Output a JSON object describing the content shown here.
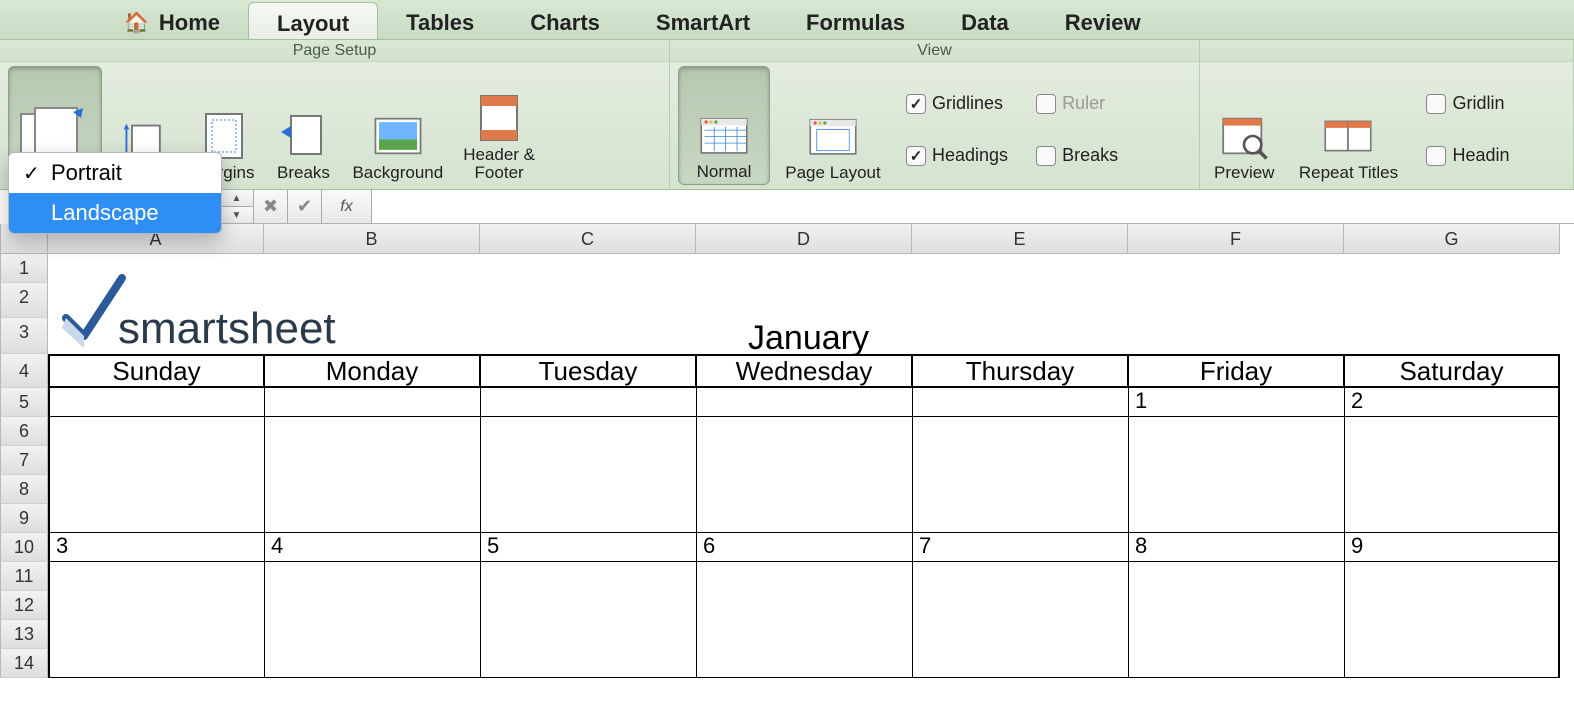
{
  "tabs": {
    "home": "Home",
    "layout": "Layout",
    "tables": "Tables",
    "charts": "Charts",
    "smartart": "SmartArt",
    "formulas": "Formulas",
    "data": "Data",
    "review": "Review"
  },
  "ribbon": {
    "page_setup": {
      "title": "Page Setup",
      "orientation": "Orientation",
      "size": "Size",
      "margins": "Margins",
      "breaks": "Breaks",
      "background": "Background",
      "header_footer": "Header &\nFooter"
    },
    "view": {
      "title": "View",
      "normal": "Normal",
      "page_layout": "Page Layout",
      "gridlines": "Gridlines",
      "ruler": "Ruler",
      "headings": "Headings",
      "breaks": "Breaks"
    },
    "print": {
      "preview": "Preview",
      "repeat_titles": "Repeat Titles",
      "gridlines": "Gridlin",
      "headings": "Headin"
    }
  },
  "orientation_menu": {
    "portrait": "Portrait",
    "landscape": "Landscape"
  },
  "formula_bar": {
    "fx": "fx",
    "value": ""
  },
  "columns": [
    "A",
    "B",
    "C",
    "D",
    "E",
    "F",
    "G"
  ],
  "rows": [
    "1",
    "2",
    "3",
    "4",
    "5",
    "6",
    "7",
    "8",
    "9",
    "10",
    "11",
    "12",
    "13",
    "14"
  ],
  "logo": "smartsheet",
  "month": "January",
  "day_headers": [
    "Sunday",
    "Monday",
    "Tuesday",
    "Wednesday",
    "Thursday",
    "Friday",
    "Saturday"
  ],
  "week1": [
    "",
    "",
    "",
    "",
    "",
    "1",
    "2"
  ],
  "week2": [
    "3",
    "4",
    "5",
    "6",
    "7",
    "8",
    "9"
  ]
}
